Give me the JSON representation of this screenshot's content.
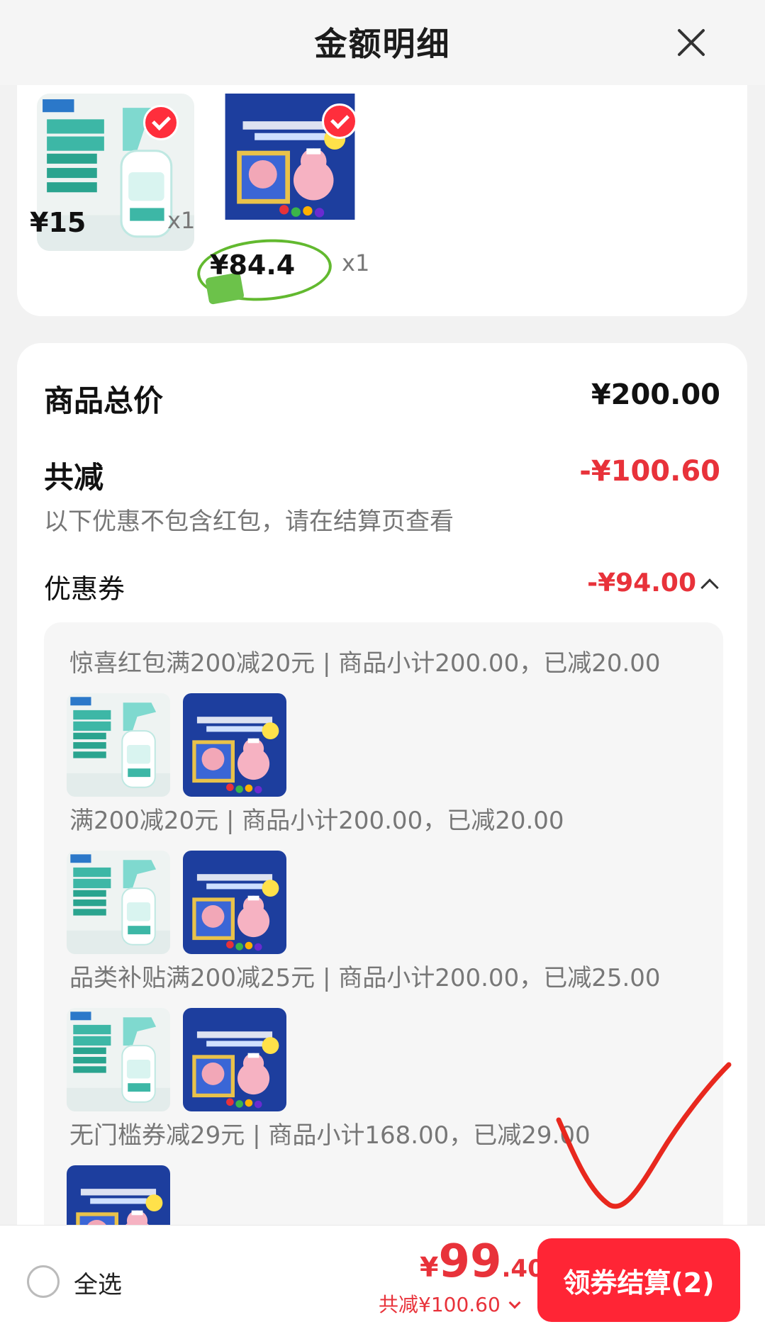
{
  "header": {
    "title": "金额明细",
    "close_icon": "close-icon"
  },
  "products": [
    {
      "name_art": "卫浴",
      "price": "¥15",
      "qty": "x1",
      "selected": true
    },
    {
      "name_art": "POP! THE PIG 大嘴猪",
      "price": "¥84.4",
      "qty": "x1",
      "selected": true
    }
  ],
  "summary": {
    "total_label": "商品总价",
    "total_value": "¥200.00",
    "discount_label": "共减",
    "discount_value": "-¥100.60",
    "discount_note": "以下优惠不包含红包，请在结算页查看",
    "coupon_label": "优惠券",
    "coupon_value": "-¥94.00"
  },
  "coupons": [
    {
      "text": "惊喜红包满200减20元 | 商品小计200.00，已减20.00"
    },
    {
      "text": "满200减20元 | 商品小计200.00，已减20.00"
    },
    {
      "text": "品类补贴满200减25元 | 商品小计200.00，已减25.00"
    },
    {
      "text": "无门槛券减29元 | 商品小计168.00，已减29.00"
    }
  ],
  "bottom": {
    "select_all": "全选",
    "total_yen": "¥",
    "total_int": "99",
    "total_dec": ".40",
    "saved": "共减¥100.60",
    "checkout": "领券结算(2)"
  },
  "colors": {
    "accent": "#ff2535",
    "discount": "#e8323a",
    "check_green": "#62b92f"
  }
}
